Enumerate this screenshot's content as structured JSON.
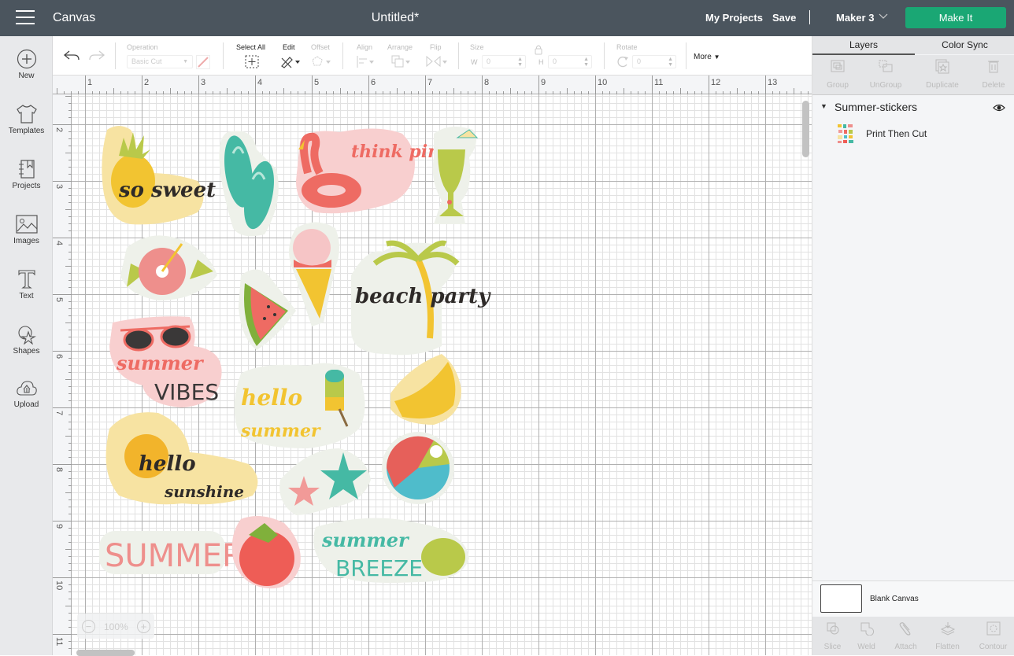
{
  "topbar": {
    "menu_icon": "hamburger-menu-icon",
    "app_title": "Canvas",
    "doc_title": "Untitled*",
    "my_projects": "My Projects",
    "save": "Save",
    "separator": "|",
    "machine": "Maker 3",
    "make_it": "Make It",
    "make_it_color": "#1aa774"
  },
  "leftnav": {
    "items": [
      {
        "label": "New",
        "icon": "plus-circle-icon"
      },
      {
        "label": "Templates",
        "icon": "tshirt-icon"
      },
      {
        "label": "Projects",
        "icon": "notebook-icon"
      },
      {
        "label": "Images",
        "icon": "image-icon"
      },
      {
        "label": "Text",
        "icon": "text-t-icon"
      },
      {
        "label": "Shapes",
        "icon": "shapes-icon"
      },
      {
        "label": "Upload",
        "icon": "cloud-upload-icon"
      }
    ]
  },
  "toolbar": {
    "operation_label": "Operation",
    "operation_value": "Basic Cut",
    "select_all": "Select All",
    "edit": "Edit",
    "offset": "Offset",
    "align": "Align",
    "arrange": "Arrange",
    "flip": "Flip",
    "size": "Size",
    "w_label": "W",
    "w_value": "0",
    "h_label": "H",
    "h_value": "0",
    "rotate": "Rotate",
    "rotate_value": "0",
    "more": "More"
  },
  "rulers": {
    "horizontal": [
      "1",
      "2",
      "3",
      "4",
      "5",
      "6",
      "7",
      "8",
      "9",
      "10",
      "11",
      "12",
      "13"
    ],
    "vertical": [
      "2",
      "3",
      "4",
      "5",
      "6",
      "7",
      "8",
      "9",
      "10",
      "11"
    ]
  },
  "canvas": {
    "zoom": "100%",
    "zoom_out": "−",
    "zoom_in": "+",
    "stickers": [
      {
        "name": "so-sweet-pineapple",
        "text": "so sweet"
      },
      {
        "name": "flip-flops",
        "text": ""
      },
      {
        "name": "think-pink-flamingo",
        "text": "think pink"
      },
      {
        "name": "tropical-drink",
        "text": ""
      },
      {
        "name": "hibiscus",
        "text": ""
      },
      {
        "name": "ice-cream-cone",
        "text": ""
      },
      {
        "name": "watermelon",
        "text": ""
      },
      {
        "name": "beach-party-palm",
        "text": "beach party"
      },
      {
        "name": "summer-vibes-sunglasses",
        "text": "summer",
        "text2": "VIBES"
      },
      {
        "name": "hello-summer-popsicle",
        "text": "hello",
        "text2": "summer"
      },
      {
        "name": "lemon-slice",
        "text": ""
      },
      {
        "name": "hello-sunshine-sun",
        "text": "hello",
        "text2": "sunshine"
      },
      {
        "name": "starfish",
        "text": ""
      },
      {
        "name": "beach-ball",
        "text": ""
      },
      {
        "name": "summer-letters",
        "text": "SUMMER"
      },
      {
        "name": "strawberry",
        "text": ""
      },
      {
        "name": "summer-breeze-leaf",
        "text": "summer",
        "text2": "BREEZE"
      }
    ]
  },
  "rightpanel": {
    "tabs": [
      {
        "label": "Layers",
        "active": true
      },
      {
        "label": "Color Sync",
        "active": false
      }
    ],
    "actions": [
      "Group",
      "UnGroup",
      "Duplicate",
      "Delete"
    ],
    "layer_group": "Summer-stickers",
    "layer_item": "Print Then Cut",
    "blank_canvas": "Blank Canvas",
    "bottom_actions": [
      "Slice",
      "Weld",
      "Attach",
      "Flatten",
      "Contour"
    ]
  }
}
